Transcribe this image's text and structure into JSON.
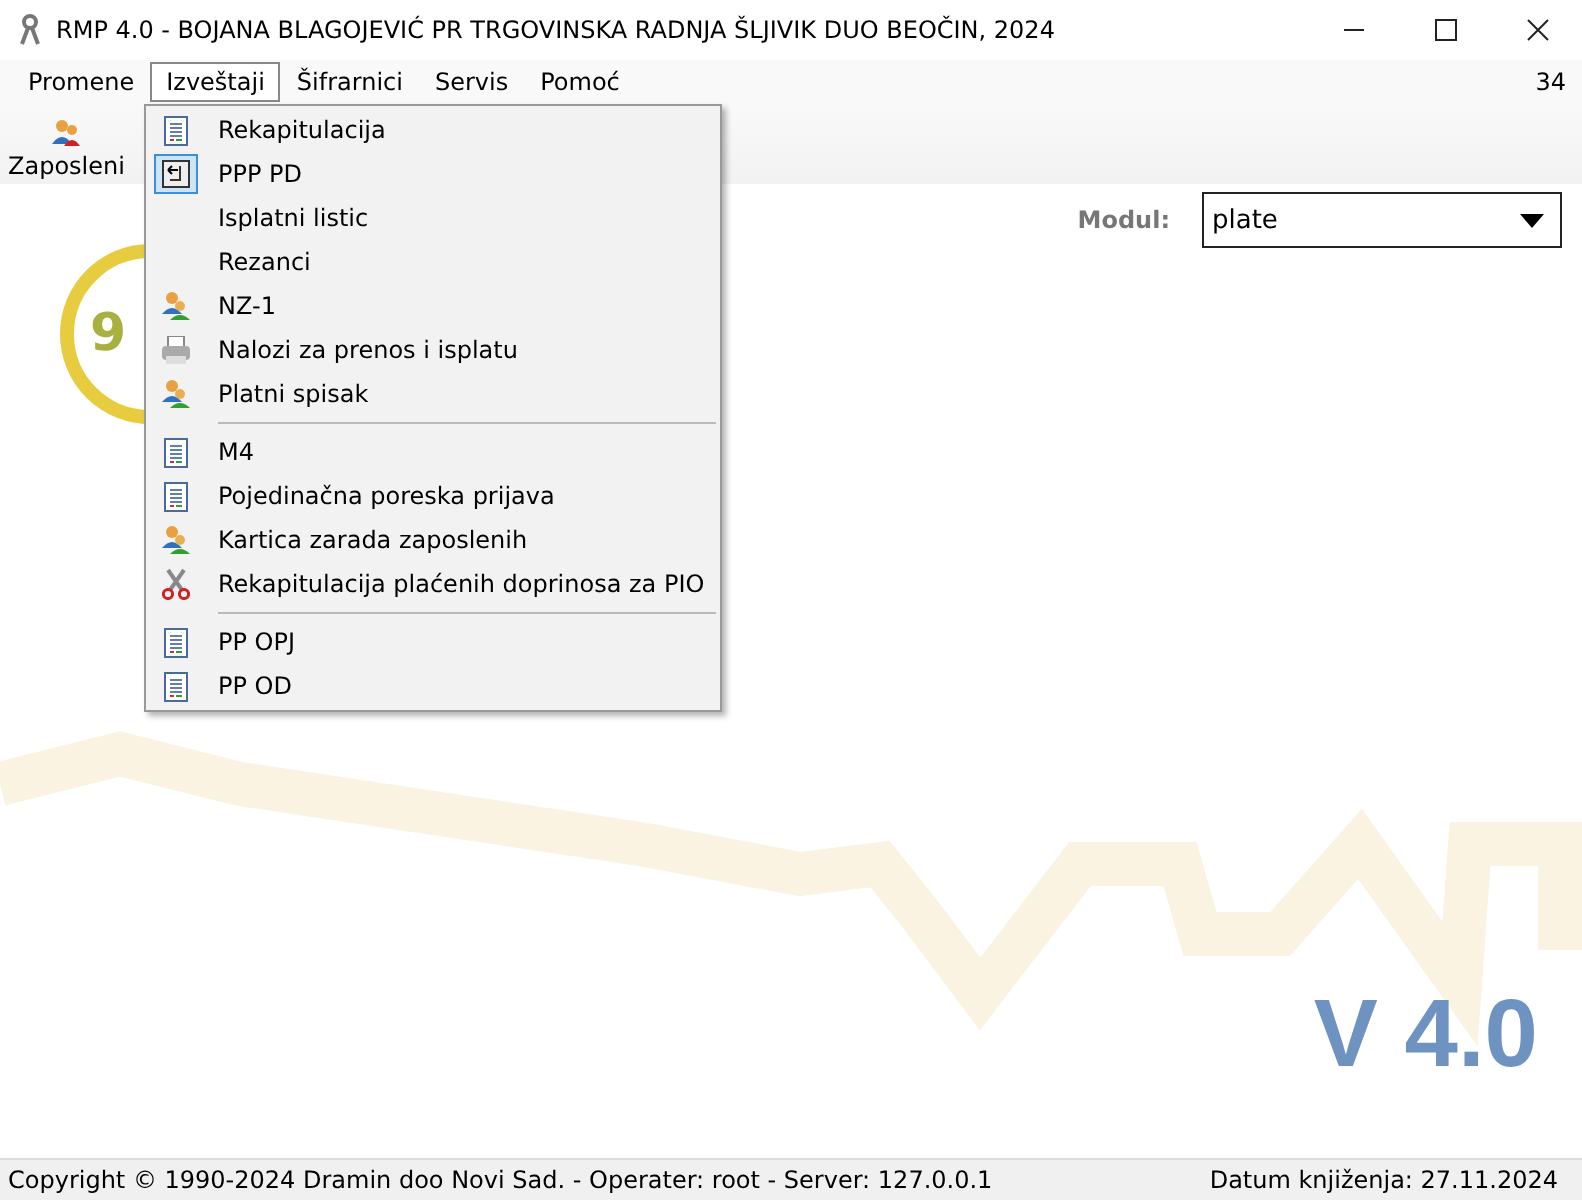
{
  "window": {
    "title": "RMP 4.0 - BOJANA BLAGOJEVIĆ PR TRGOVINSKA RADNJA ŠLJIVIK DUO BEOČIN, 2024"
  },
  "menu_bar": {
    "items": [
      {
        "label": "Promene",
        "selected": false
      },
      {
        "label": "Izveštaji",
        "selected": true
      },
      {
        "label": "Šifrarnici",
        "selected": false
      },
      {
        "label": "Servis",
        "selected": false
      },
      {
        "label": "Pomoć",
        "selected": false
      }
    ],
    "right_text": "34"
  },
  "toolbar": {
    "items": [
      {
        "label": "Zaposleni",
        "kind": "people"
      }
    ]
  },
  "dropdown_menu": {
    "groups": [
      [
        {
          "label": "Rekapitulacija",
          "kind": "report",
          "checked": false
        },
        {
          "label": "PPP PD",
          "kind": "back",
          "checked": true
        },
        {
          "label": "Isplatni listic",
          "kind": "none",
          "checked": false
        },
        {
          "label": "Rezanci",
          "kind": "none",
          "checked": false
        },
        {
          "label": "NZ-1",
          "kind": "people",
          "checked": false
        },
        {
          "label": "Nalozi za prenos i isplatu",
          "kind": "printer",
          "checked": false
        },
        {
          "label": "Platni spisak",
          "kind": "people",
          "checked": false
        }
      ],
      [
        {
          "label": "M4",
          "kind": "report",
          "checked": false
        },
        {
          "label": "Pojedinačna poreska prijava",
          "kind": "report",
          "checked": false
        },
        {
          "label": "Kartica zarada zaposlenih",
          "kind": "people",
          "checked": false
        },
        {
          "label": "Rekapitulacija plaćenih doprinosa za PIO",
          "kind": "scissors",
          "checked": false
        }
      ],
      [
        {
          "label": "PP OPJ",
          "kind": "report",
          "checked": false
        },
        {
          "label": "PP OD",
          "kind": "report",
          "checked": false
        }
      ]
    ]
  },
  "module": {
    "label": "Modul:",
    "value": "plate"
  },
  "logo": {
    "text": "9"
  },
  "version": "V 4.0",
  "status_bar": {
    "left": "Copyright © 1990-2024 Dramin doo Novi Sad. - Operater: root - Server: 127.0.0.1",
    "right": "Datum knjiženja: 27.11.2024"
  }
}
